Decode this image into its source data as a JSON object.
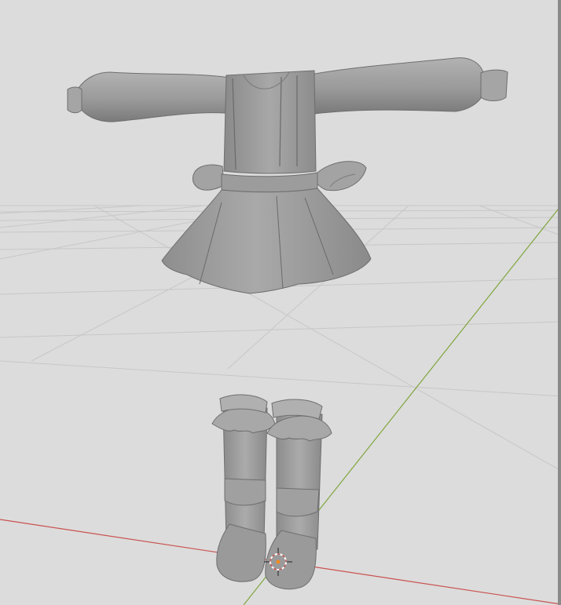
{
  "viewport": {
    "background": "#dcdcdc",
    "grid_color": "#c6c6c6",
    "x_axis_color": "#c9524f",
    "y_axis_color": "#7fa63c",
    "mesh_color": "#9a9a9a",
    "mesh_shadow": "#6e6e6e",
    "mesh_highlight": "#c4c4c4"
  },
  "objects": [
    {
      "name": "shirt-with-sleeves",
      "kind": "mesh"
    },
    {
      "name": "skirt",
      "kind": "mesh"
    },
    {
      "name": "wing-accessories",
      "kind": "mesh"
    },
    {
      "name": "boots-pair",
      "kind": "mesh"
    }
  ],
  "cursor_3d": {
    "name": "3d-cursor"
  }
}
